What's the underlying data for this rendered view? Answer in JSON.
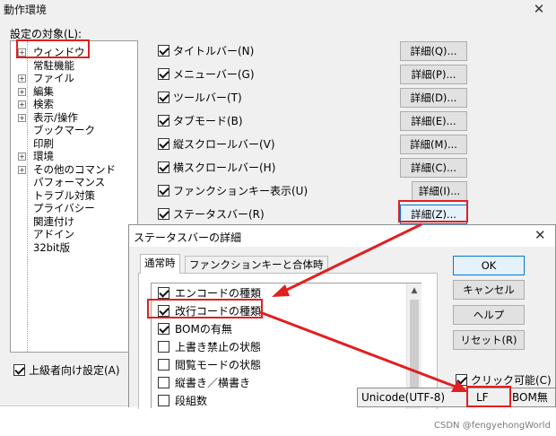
{
  "main": {
    "title": "動作環境",
    "close_glyph": "✕",
    "tree_label": "設定の対象(L):",
    "tree_items": [
      {
        "label": "ウィンドウ",
        "expander": "+"
      },
      {
        "label": "常駐機能",
        "expander": ""
      },
      {
        "label": "ファイル",
        "expander": "+"
      },
      {
        "label": "編集",
        "expander": "+"
      },
      {
        "label": "検索",
        "expander": "+"
      },
      {
        "label": "表示/操作",
        "expander": "+"
      },
      {
        "label": "ブックマーク",
        "expander": ""
      },
      {
        "label": "印刷",
        "expander": ""
      },
      {
        "label": "環境",
        "expander": "+"
      },
      {
        "label": "その他のコマンド",
        "expander": "+"
      },
      {
        "label": "パフォーマンス",
        "expander": ""
      },
      {
        "label": "トラブル対策",
        "expander": ""
      },
      {
        "label": "プライバシー",
        "expander": ""
      },
      {
        "label": "関連付け",
        "expander": ""
      },
      {
        "label": "アドイン",
        "expander": ""
      },
      {
        "label": "32bit版",
        "expander": ""
      }
    ],
    "options": [
      {
        "label": "タイトルバー(N)",
        "button": "詳細(Q)...",
        "checked": true
      },
      {
        "label": "メニューバー(G)",
        "button": "詳細(P)...",
        "checked": true
      },
      {
        "label": "ツールバー(T)",
        "button": "詳細(D)...",
        "checked": true
      },
      {
        "label": "タブモード(B)",
        "button": "詳細(E)...",
        "checked": true
      },
      {
        "label": "縦スクロールバー(V)",
        "button": "詳細(M)...",
        "checked": true
      },
      {
        "label": "横スクロールバー(H)",
        "button": "詳細(C)...",
        "checked": true
      },
      {
        "label": "ファンクションキー表示(U)",
        "button": "詳細(I)...",
        "checked": true
      },
      {
        "label": "ステータスバー(R)",
        "button": "詳細(Z)...",
        "checked": true
      }
    ],
    "advanced_label": "上級者向け設定(A)"
  },
  "dialog": {
    "title": "ステータスバーの詳細",
    "close_glyph": "✕",
    "tabs": [
      "通常時",
      "ファンクションキーと合体時"
    ],
    "list_items": [
      {
        "label": "エンコードの種類",
        "checked": true
      },
      {
        "label": "改行コードの種類",
        "checked": true
      },
      {
        "label": "BOMの有無",
        "checked": true
      },
      {
        "label": "上書き禁止の状態",
        "checked": false
      },
      {
        "label": "閲覧モードの状態",
        "checked": false
      },
      {
        "label": "縦書き／横書き",
        "checked": false
      },
      {
        "label": "段組数",
        "checked": false
      }
    ],
    "buttons": {
      "ok": "OK",
      "cancel": "キャンセル",
      "help": "ヘルプ",
      "reset": "リセット(R)"
    },
    "clickable_label": "クリック可能(C)"
  },
  "status_preview": {
    "encoding": "Unicode(UTF-8)",
    "newline": "LF",
    "bom": "BOM無"
  },
  "watermark": "CSDN @fengyehongWorld",
  "colors": {
    "annotation_red": "#e02020",
    "focus_blue": "#0078d7",
    "dialog_bg": "#f0f0f0"
  }
}
